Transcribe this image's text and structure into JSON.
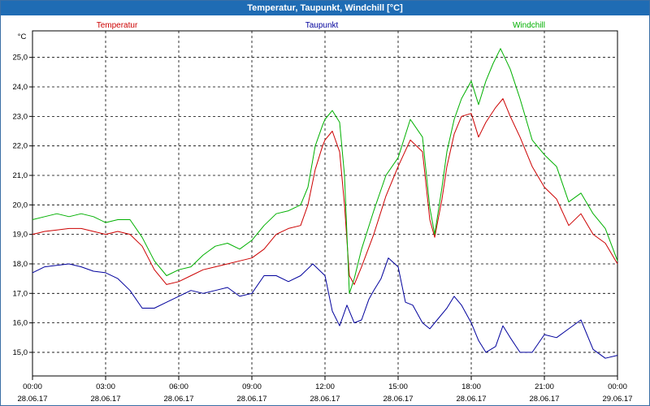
{
  "window": {
    "title": "Temperatur, Taupunkt, Windchill [°C]"
  },
  "colors": {
    "Temperatur": "#cc0000",
    "Taupunkt": "#00009c",
    "Windchill": "#00b000",
    "title_bar": "#1f6cb4"
  },
  "chart_data": {
    "type": "line",
    "title": "Temperatur, Taupunkt, Windchill [°C]",
    "y_unit": "°C",
    "ylim": [
      14.2,
      25.9
    ],
    "xlim": [
      0,
      24
    ],
    "grid": true,
    "legend_placement": "top",
    "y_ticks": [
      "15,0",
      "16,0",
      "17,0",
      "18,0",
      "19,0",
      "20,0",
      "21,0",
      "22,0",
      "23,0",
      "24,0",
      "25,0"
    ],
    "y_tick_values": [
      15,
      16,
      17,
      18,
      19,
      20,
      21,
      22,
      23,
      24,
      25
    ],
    "x_ticks": [
      {
        "time": "00:00",
        "date": "28.06.17"
      },
      {
        "time": "03:00",
        "date": "28.06.17"
      },
      {
        "time": "06:00",
        "date": "28.06.17"
      },
      {
        "time": "09:00",
        "date": "28.06.17"
      },
      {
        "time": "12:00",
        "date": "28.06.17"
      },
      {
        "time": "15:00",
        "date": "28.06.17"
      },
      {
        "time": "18:00",
        "date": "28.06.17"
      },
      {
        "time": "21:00",
        "date": "28.06.17"
      },
      {
        "time": "00:00",
        "date": "29.06.17"
      }
    ],
    "x_tick_hours": [
      0,
      3,
      6,
      9,
      12,
      15,
      18,
      21,
      24
    ],
    "series": [
      {
        "name": "Temperatur",
        "x": [
          0,
          0.5,
          1,
          1.5,
          2,
          2.5,
          3,
          3.5,
          4,
          4.5,
          5,
          5.5,
          6,
          6.5,
          7,
          7.5,
          8,
          8.5,
          9,
          9.5,
          10,
          10.5,
          11,
          11.3,
          11.6,
          11.9,
          12,
          12.3,
          12.6,
          12.8,
          13,
          13.2,
          13.5,
          14,
          14.5,
          15,
          15.5,
          16,
          16.3,
          16.5,
          16.8,
          17,
          17.3,
          17.6,
          18,
          18.3,
          18.6,
          19,
          19.3,
          19.6,
          20,
          20.5,
          21,
          21.5,
          22,
          22.5,
          23,
          23.5,
          24
        ],
        "values": [
          19.0,
          19.1,
          19.15,
          19.2,
          19.2,
          19.1,
          19.0,
          19.1,
          19.0,
          18.6,
          17.8,
          17.3,
          17.4,
          17.6,
          17.8,
          17.9,
          18.0,
          18.1,
          18.2,
          18.5,
          19.0,
          19.2,
          19.3,
          20.0,
          21.2,
          22.0,
          22.2,
          22.5,
          21.8,
          20.0,
          17.6,
          17.3,
          17.9,
          19.0,
          20.3,
          21.3,
          22.2,
          21.8,
          19.5,
          18.9,
          20.2,
          21.3,
          22.4,
          23.0,
          23.1,
          22.3,
          22.8,
          23.3,
          23.6,
          23.0,
          22.3,
          21.3,
          20.6,
          20.2,
          19.3,
          19.7,
          19.0,
          18.7,
          18.0
        ]
      },
      {
        "name": "Taupunkt",
        "x": [
          0,
          0.5,
          1,
          1.5,
          2,
          2.5,
          3,
          3.5,
          4,
          4.5,
          5,
          5.5,
          6,
          6.5,
          7,
          7.5,
          8,
          8.5,
          9,
          9.5,
          10,
          10.5,
          11,
          11.5,
          12,
          12.3,
          12.6,
          12.9,
          13.2,
          13.5,
          13.8,
          14,
          14.3,
          14.6,
          15,
          15.3,
          15.6,
          16,
          16.3,
          16.6,
          17,
          17.3,
          17.6,
          18,
          18.3,
          18.6,
          19,
          19.3,
          19.6,
          20,
          20.5,
          21,
          21.5,
          22,
          22.5,
          23,
          23.5,
          24
        ],
        "values": [
          17.7,
          17.9,
          17.95,
          18.0,
          17.9,
          17.75,
          17.7,
          17.5,
          17.1,
          16.5,
          16.5,
          16.7,
          16.9,
          17.1,
          17.0,
          17.1,
          17.2,
          16.9,
          17.0,
          17.6,
          17.6,
          17.4,
          17.6,
          18.0,
          17.6,
          16.4,
          15.9,
          16.6,
          16.0,
          16.1,
          16.8,
          17.1,
          17.5,
          18.2,
          17.9,
          16.7,
          16.6,
          16.0,
          15.8,
          16.1,
          16.5,
          16.9,
          16.6,
          16.0,
          15.4,
          15.0,
          15.2,
          15.9,
          15.5,
          15.0,
          15.0,
          15.6,
          15.5,
          15.8,
          16.1,
          15.1,
          14.8,
          14.9
        ]
      },
      {
        "name": "Windchill",
        "x": [
          0,
          0.5,
          1,
          1.5,
          2,
          2.5,
          3,
          3.5,
          4,
          4.5,
          5,
          5.5,
          6,
          6.5,
          7,
          7.5,
          8,
          8.5,
          9,
          9.5,
          10,
          10.5,
          11,
          11.3,
          11.6,
          11.9,
          12,
          12.3,
          12.6,
          12.8,
          13,
          13.2,
          13.5,
          14,
          14.5,
          15,
          15.5,
          16,
          16.3,
          16.5,
          16.8,
          17,
          17.3,
          17.6,
          18,
          18.3,
          18.6,
          18.9,
          19.2,
          19.6,
          20,
          20.5,
          21,
          21.5,
          22,
          22.5,
          23,
          23.5,
          24
        ],
        "values": [
          19.5,
          19.6,
          19.7,
          19.6,
          19.7,
          19.6,
          19.4,
          19.5,
          19.5,
          18.9,
          18.1,
          17.6,
          17.8,
          17.9,
          18.3,
          18.6,
          18.7,
          18.5,
          18.8,
          19.3,
          19.7,
          19.8,
          20.0,
          20.6,
          22.0,
          22.7,
          22.9,
          23.2,
          22.8,
          21.0,
          17.0,
          17.5,
          18.5,
          19.8,
          21.0,
          21.6,
          22.9,
          22.3,
          19.9,
          19.0,
          20.6,
          21.8,
          22.9,
          23.6,
          24.2,
          23.4,
          24.2,
          24.8,
          25.3,
          24.6,
          23.6,
          22.2,
          21.7,
          21.3,
          20.1,
          20.4,
          19.7,
          19.2,
          18.1
        ]
      }
    ]
  }
}
